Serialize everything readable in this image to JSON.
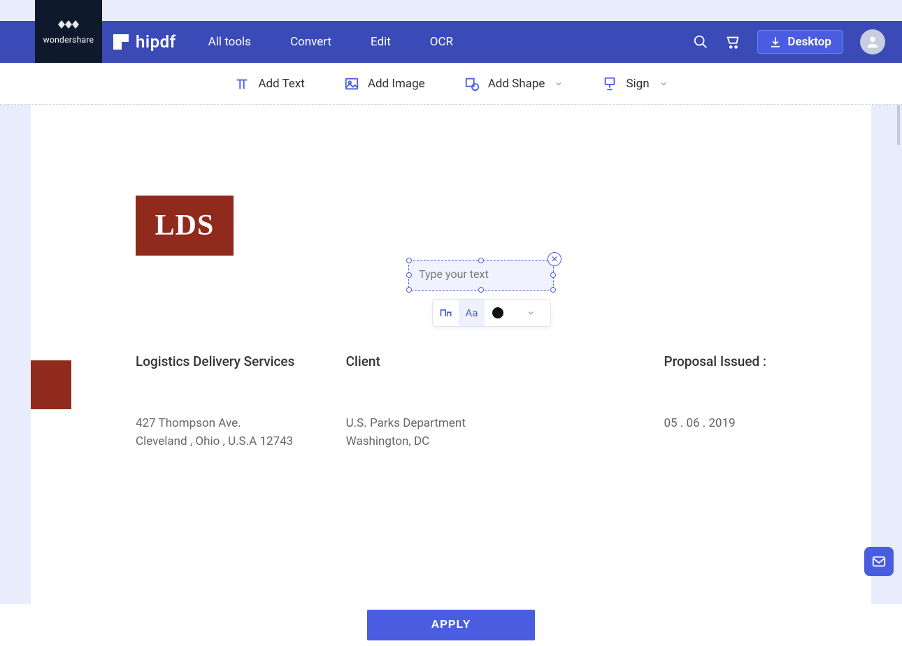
{
  "badge": {
    "brand": "wondershare"
  },
  "header": {
    "product": "hipdf",
    "nav": {
      "all_tools": "All tools",
      "convert": "Convert",
      "edit": "Edit",
      "ocr": "OCR"
    },
    "desktop_label": "Desktop"
  },
  "toolbar": {
    "add_text": "Add Text",
    "add_image": "Add Image",
    "add_shape": "Add Shape",
    "sign": "Sign"
  },
  "textbox": {
    "placeholder": "Type your text",
    "font_case_label": "Aa"
  },
  "document": {
    "logo_text": "LDS",
    "company": {
      "title": "Logistics Delivery Services",
      "line1": "427 Thompson Ave.",
      "line2": "Cleveland , Ohio , U.S.A 12743"
    },
    "client": {
      "title": "Client",
      "line1": "U.S. Parks Department",
      "line2": "Washington, DC"
    },
    "issued": {
      "title": "Proposal Issued :",
      "date": "05 . 06 . 2019"
    }
  },
  "footer": {
    "apply": "APPLY"
  }
}
